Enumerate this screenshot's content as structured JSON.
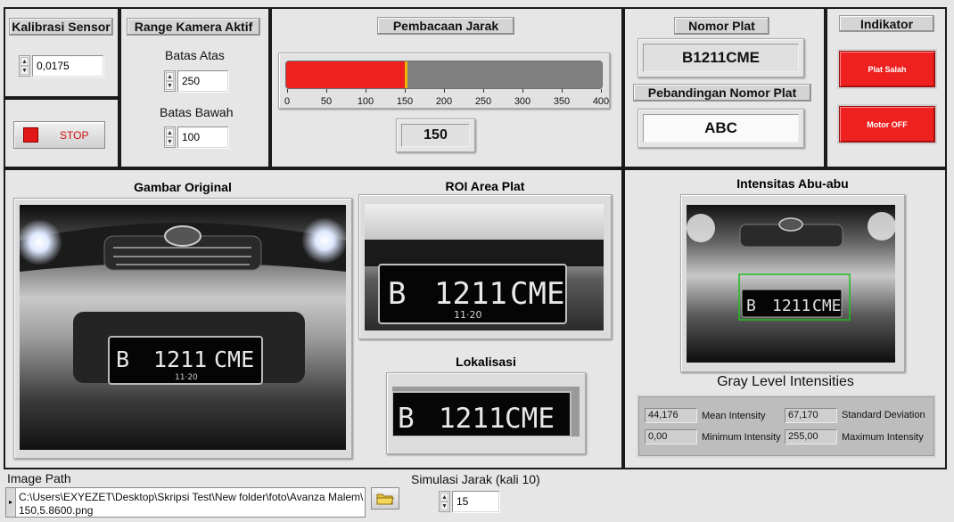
{
  "kalibrasi": {
    "title": "Kalibrasi Sensor",
    "value": "0,0175"
  },
  "stop_button": {
    "label": "STOP"
  },
  "range": {
    "title": "Range Kamera Aktif",
    "upper_label": "Batas Atas",
    "upper_value": "250",
    "lower_label": "Batas Bawah",
    "lower_value": "100"
  },
  "jarak": {
    "title": "Pembacaan Jarak",
    "value": "150",
    "fraction": 0.375,
    "ticks": [
      "0",
      "50",
      "100",
      "150",
      "200",
      "250",
      "300",
      "350",
      "400"
    ]
  },
  "nomor_plat": {
    "title": "Nomor Plat",
    "value": "B1211CME"
  },
  "pebandingan": {
    "title": "Pebandingan Nomor Plat",
    "value": "ABC"
  },
  "indikator": {
    "title": "Indikator",
    "led1": "Plat Salah",
    "led2": "Motor OFF"
  },
  "original": {
    "title": "Gambar Original",
    "plate_left": "B",
    "plate_mid": "1211",
    "plate_right": "CME",
    "plate_sub": "11·20"
  },
  "roi": {
    "title": "ROI Area Plat"
  },
  "lokalisasi": {
    "title": "Lokalisasi"
  },
  "intensitas": {
    "title": "Intensitas Abu-abu",
    "gray_title": "Gray Level Intensities"
  },
  "stats": {
    "mean_value": "44,176",
    "mean_label": "Mean Intensity",
    "std_value": "67,170",
    "std_label": "Standard  Deviation",
    "min_value": "0,00",
    "min_label": "Minimum Intensity",
    "max_value": "255,00",
    "max_label": "Maximum Intensity"
  },
  "image_path": {
    "label": "Image Path",
    "line1": "C:\\Users\\EXYEZET\\Desktop\\Skripsi Test\\New folder\\foto\\Avanza Malem\\",
    "line2": "150,5.8600.png"
  },
  "simulasi": {
    "label": "Simulasi Jarak (kali 10)",
    "value": "15"
  },
  "colors": {
    "led_red": "#ee2020",
    "bar_red": "#ee2020",
    "bar_gray": "#808080",
    "bar_marker": "#f2b705",
    "roi_box": "#22bb22"
  },
  "icons": [
    "folder-icon",
    "stop-square-icon",
    "spin-up-icon",
    "spin-down-icon",
    "path-icon"
  ]
}
